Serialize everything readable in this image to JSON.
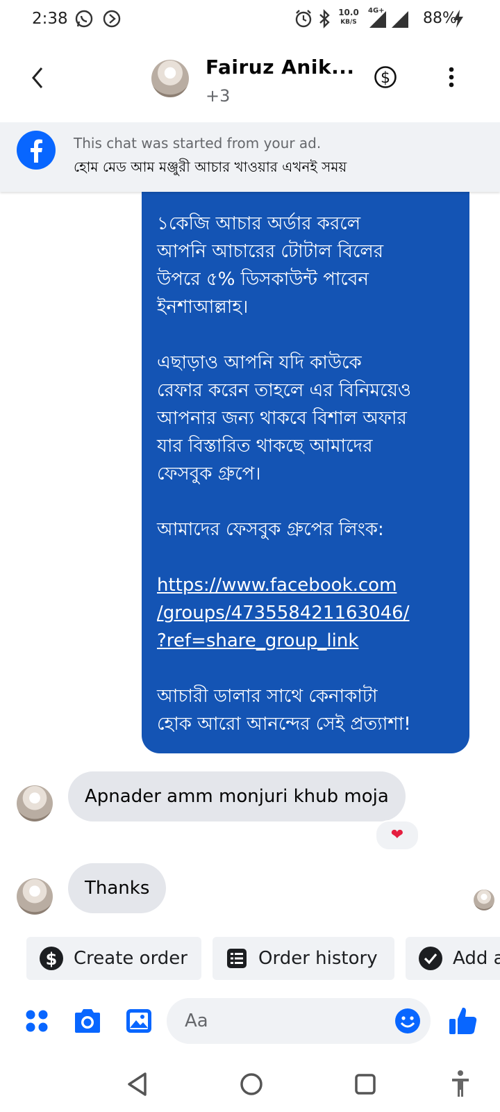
{
  "status_bar": {
    "time": "2:38",
    "net_speed_value": "10.0",
    "net_speed_unit": "KB/S",
    "network": "4G+",
    "battery": "88%"
  },
  "header": {
    "title": "Fairuz Anik...",
    "subtitle": "+3",
    "icons": [
      "back-chevron-icon",
      "dollar-circle-icon",
      "more-vertical-icon"
    ]
  },
  "ad_banner": {
    "line1": "This chat was started from your ad.",
    "line2": "হোম মেড আম মঞ্জুরী আচার খাওয়ার এখনই সময়"
  },
  "messages": [
    {
      "direction": "outgoing",
      "text_part1": "১কেজি আচার অর্ডার করলে\nআপনি আচারের টোটাল বিলের\nউপরে ৫% ডিসকাউন্ট পাবেন\nইনশাআল্লাহ।\n\nএছাড়াও আপনি যদি কাউকে\nরেফার করেন তাহলে এর বিনিময়েও\nআপনার জন্য থাকবে বিশাল অফার\nযার বিস্তারিত থাকছে আমাদের\nফেসবুক গ্রুপে।\n\nআমাদের ফেসবুক গ্রুপের লিংক:\n\n",
      "link": "https://www.facebook.com\n/groups/473558421163046/\n?ref=share_group_link",
      "text_part2": "\n\nআচারী ডালার সাথে কেনাকাটা\nহোক আরো আনন্দের সেই প্রত্যাশা!"
    },
    {
      "direction": "incoming",
      "text": "Apnader amm monjuri khub moja",
      "reaction": "❤"
    },
    {
      "direction": "incoming",
      "text": "Thanks"
    }
  ],
  "quick_actions": [
    {
      "label": "Create order",
      "icon": "dollar-circle-icon"
    },
    {
      "label": "Order history",
      "icon": "receipt-list-icon"
    },
    {
      "label": "Add a",
      "icon": "check-circle-icon"
    }
  ],
  "composer": {
    "placeholder": "Aa",
    "icons": [
      "apps-menu-icon",
      "camera-icon",
      "gallery-icon",
      "emoji-icon",
      "thumbs-up-icon"
    ]
  },
  "nav_bar": {
    "icons": [
      "back-triangle-icon",
      "home-circle-icon",
      "recents-square-icon",
      "accessibility-icon"
    ]
  },
  "colors": {
    "accent": "#0866ff",
    "outgoing_bubble": "#1454b4",
    "incoming_bubble": "#e4e6eb",
    "banner_bg": "#f0f2f5",
    "reaction_heart": "#e41e3f"
  }
}
